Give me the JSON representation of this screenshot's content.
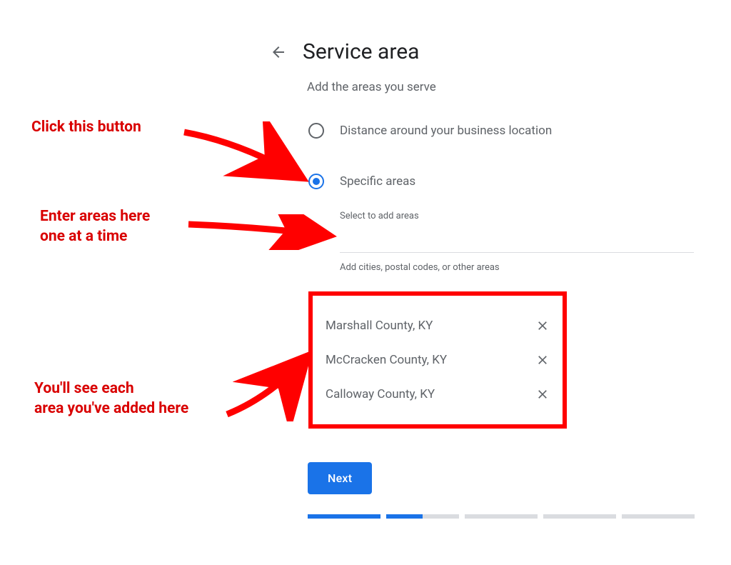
{
  "page_title": "Service area",
  "subtitle": "Add the areas you serve",
  "radio": {
    "distance_label": "Distance around your business location",
    "specific_label": "Specific areas"
  },
  "input": {
    "floating_label": "Select to add areas",
    "helper_text": "Add cities, postal codes, or other areas",
    "value": ""
  },
  "added_areas": [
    "Marshall County, KY",
    "McCracken County, KY",
    "Calloway County, KY"
  ],
  "next_label": "Next",
  "annotations": {
    "click_button": "Click this button",
    "enter_areas": "Enter areas here\none at a time",
    "see_added": "You'll see each\narea you've added here"
  }
}
